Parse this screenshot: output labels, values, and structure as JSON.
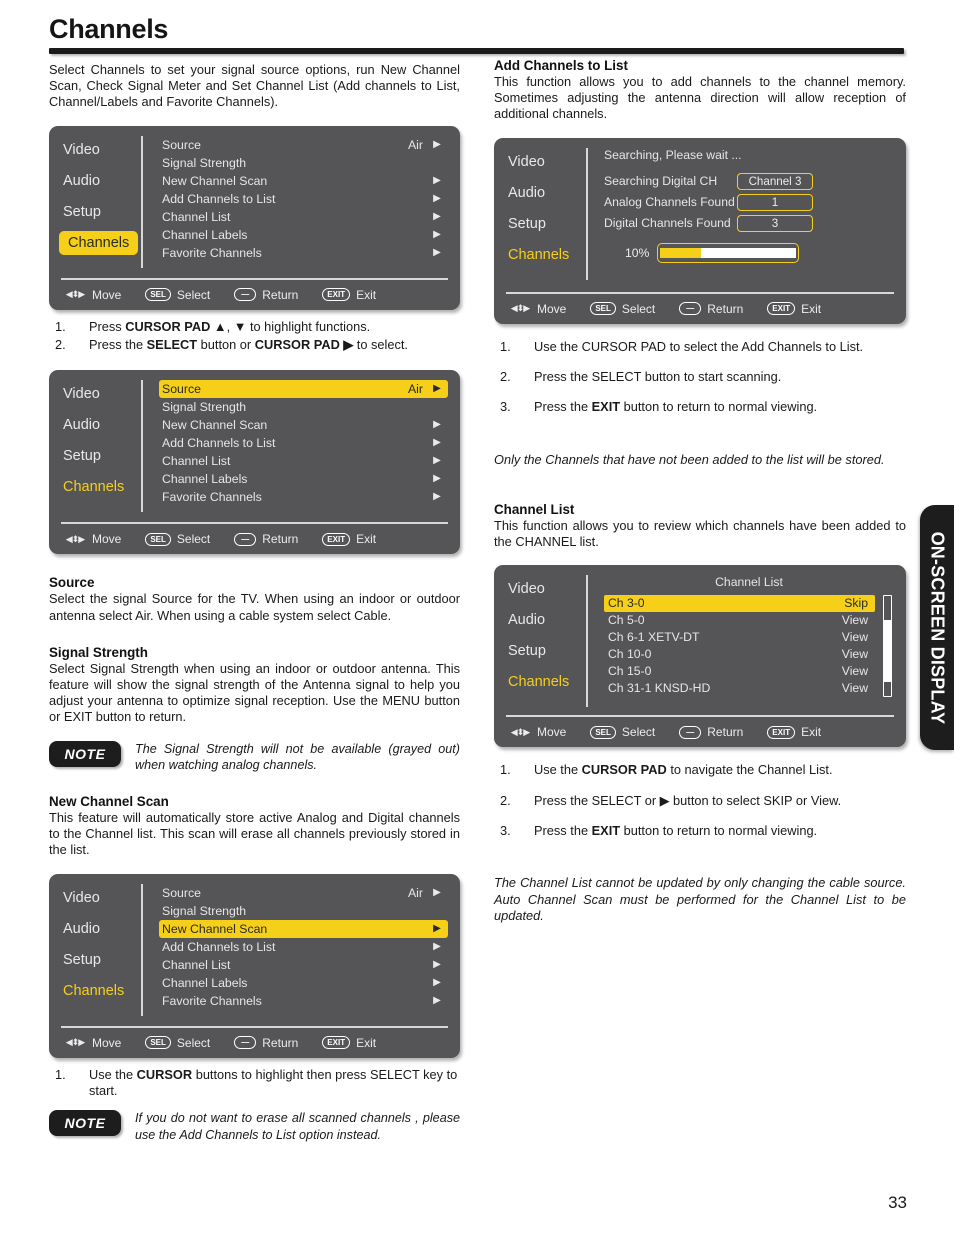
{
  "page": {
    "title": "Channels",
    "number": "33",
    "side_tab": "ON-SCREEN DISPLAY"
  },
  "left": {
    "intro": "Select Channels to set your signal source options, run New Channel Scan, Check Signal Meter and Set Channel List (Add channels to List, Channel/Labels and Favorite Channels).",
    "steps_1": [
      {
        "num": "1.",
        "html": "Press <b>CURSOR PAD ▲</b>, <b>▼</b> to highlight functions."
      },
      {
        "num": "2.",
        "html": "Press the <b>SELECT</b> button or <b>CURSOR PAD ▶</b> to select."
      }
    ],
    "source": {
      "heading": "Source",
      "body": "Select the signal Source for the TV. When using an indoor or outdoor antenna select Air. When using a cable system select Cable."
    },
    "signal_strength": {
      "heading": "Signal Strength",
      "body": "Select Signal Strength when using an indoor or outdoor antenna. This feature will show the signal strength of the Antenna signal to help you adjust your antenna to optimize signal reception. Use the MENU button or EXIT button to return."
    },
    "note_1": {
      "badge": "NOTE",
      "text": "The Signal Strength will not be available (grayed out) when watching analog channels."
    },
    "new_channel_scan": {
      "heading": "New Channel Scan",
      "body": "This feature will automatically store active Analog and Digital channels to the Channel list. This scan will erase all channels previously stored in the list."
    },
    "steps_2": [
      {
        "num": "1.",
        "html": "Use the <b>CURSOR</b> buttons to highlight then press SELECT key to start."
      }
    ],
    "note_2": {
      "badge": "NOTE",
      "text": "If you do not want to erase all scanned channels , please use the Add Channels to List option instead."
    }
  },
  "right": {
    "add_channels": {
      "heading": "Add Channels to List",
      "body": "This function allows you to add channels to the channel memory. Sometimes adjusting the antenna direction will allow reception of additional channels."
    },
    "steps_add": [
      {
        "num": "1.",
        "html": "Use the CURSOR PAD to select the Add Channels to List."
      },
      {
        "num": "2.",
        "html": "Press the SELECT button to start scanning."
      },
      {
        "num": "3.",
        "html": "Press the <b>EXIT</b> button to return to normal viewing."
      }
    ],
    "note_add": "Only the Channels that have not been added to the list will be stored.",
    "channel_list": {
      "heading": "Channel List",
      "body": "This function allows you to review which channels have been added to the CHANNEL list."
    },
    "steps_list": [
      {
        "num": "1.",
        "html": "Use the <b>CURSOR PAD</b> to navigate the Channel List."
      },
      {
        "num": "2.",
        "html": "Press the SELECT or ▶ button to select SKIP or View."
      },
      {
        "num": "3.",
        "html": "Press the <b>EXIT</b> button to return to normal viewing."
      }
    ],
    "note_list": "The Channel List cannot be updated by only changing the cable source. Auto Channel Scan must be performed for the Channel List to be updated."
  },
  "osd_common": {
    "categories": [
      "Video",
      "Audio",
      "Setup",
      "Channels"
    ],
    "footer": [
      {
        "icon": "cursor-pad-icon",
        "glyph": "◀⬍▶",
        "label": "Move"
      },
      {
        "icon": "select-key-icon",
        "glyph": "SEL",
        "label": "Select"
      },
      {
        "icon": "return-key-icon",
        "glyph": "—",
        "label": "Return"
      },
      {
        "icon": "exit-key-icon",
        "glyph": "EXIT",
        "label": "Exit"
      }
    ],
    "menu_items": [
      {
        "label": "Source",
        "value": "Air",
        "arrow": "▶"
      },
      {
        "label": "Signal Strength",
        "value": "",
        "arrow": ""
      },
      {
        "label": "New Channel Scan",
        "value": "",
        "arrow": "▶"
      },
      {
        "label": "Add Channels to List",
        "value": "",
        "arrow": "▶"
      },
      {
        "label": "Channel List",
        "value": "",
        "arrow": "▶"
      },
      {
        "label": "Channel Labels",
        "value": "",
        "arrow": "▶"
      },
      {
        "label": "Favorite Channels",
        "value": "",
        "arrow": "▶"
      }
    ],
    "accent_color": "#f5cf18",
    "panel_color": "#555558"
  },
  "osd_scan": {
    "wait_text": "Searching, Please wait ...",
    "rows": [
      {
        "label": "Searching Digital CH",
        "value": "Channel 3"
      },
      {
        "label": "Analog Channels Found",
        "value": "1"
      },
      {
        "label": "Digital Channels Found",
        "value": "3"
      }
    ],
    "progress_percent": "10%",
    "progress_fill": 30
  },
  "osd_channel_list": {
    "title": "Channel List",
    "rows": [
      {
        "name": "Ch 3-0",
        "state": "Skip"
      },
      {
        "name": "Ch 5-0",
        "state": "View"
      },
      {
        "name": "Ch 6-1 XETV-DT",
        "state": "View"
      },
      {
        "name": "Ch 10-0",
        "state": "View"
      },
      {
        "name": "Ch 15-0",
        "state": "View"
      },
      {
        "name": "Ch 31-1 KNSD-HD",
        "state": "View"
      }
    ]
  }
}
